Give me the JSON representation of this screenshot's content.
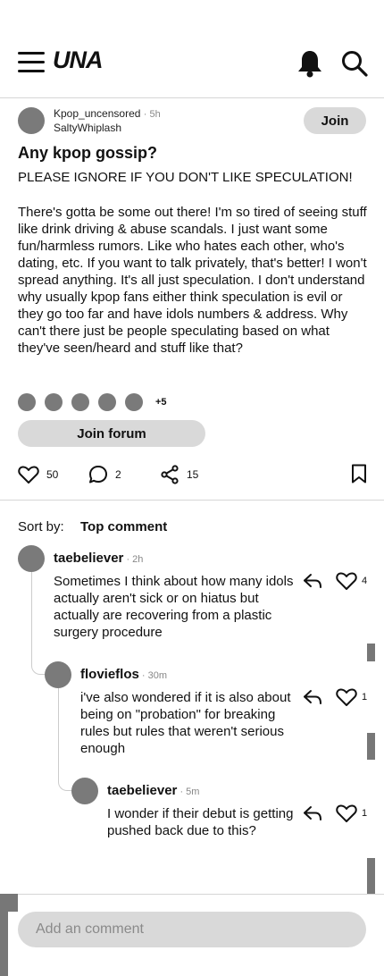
{
  "app": {
    "logo": "UNA"
  },
  "post": {
    "community": "Kpop_uncensored",
    "time": "5h",
    "username": "SaltyWhiplash",
    "join_label": "Join",
    "title": "Any kpop gossip?",
    "subtitle": "PLEASE IGNORE IF YOU DON'T LIKE SPECULATION!",
    "body": "There's gotta be some out there! I'm so tired of seeing stuff like drink driving & abuse scandals. I just want some fun/harmless rumors. Like who hates each other, who's dating, etc. If you want to talk privately, that's better! I won't spread anything. It's all just speculation. I don't understand why usually kpop fans either think speculation is evil or they go too far and have idols numbers & address. Why can't there just be people speculating based on what they've seen/heard and stuff like that?",
    "more_members": "+5",
    "join_forum_label": "Join forum",
    "likes": "50",
    "comments": "2",
    "shares": "15"
  },
  "sort": {
    "label": "Sort by:",
    "value": "Top comment"
  },
  "comments": [
    {
      "author": "taebeliever",
      "time": "2h",
      "text": "Sometimes I think about how many idols actually aren't sick or on hiatus but actually are recovering from a plastic surgery procedure",
      "likes": "4"
    },
    {
      "author": "flovieflos",
      "time": "30m",
      "text": "i've also wondered if it is also about being on \"probation\" for breaking rules but rules that weren't serious enough",
      "likes": "1"
    },
    {
      "author": "taebeliever",
      "time": "5m",
      "text": "I wonder if their debut is getting pushed back due to this?",
      "likes": "1"
    }
  ],
  "composer": {
    "placeholder": "Add an comment"
  },
  "icons": [
    "menu-icon",
    "bell-icon",
    "search-icon",
    "heart-icon",
    "comment-icon",
    "share-icon",
    "bookmark-icon",
    "reply-icon"
  ]
}
